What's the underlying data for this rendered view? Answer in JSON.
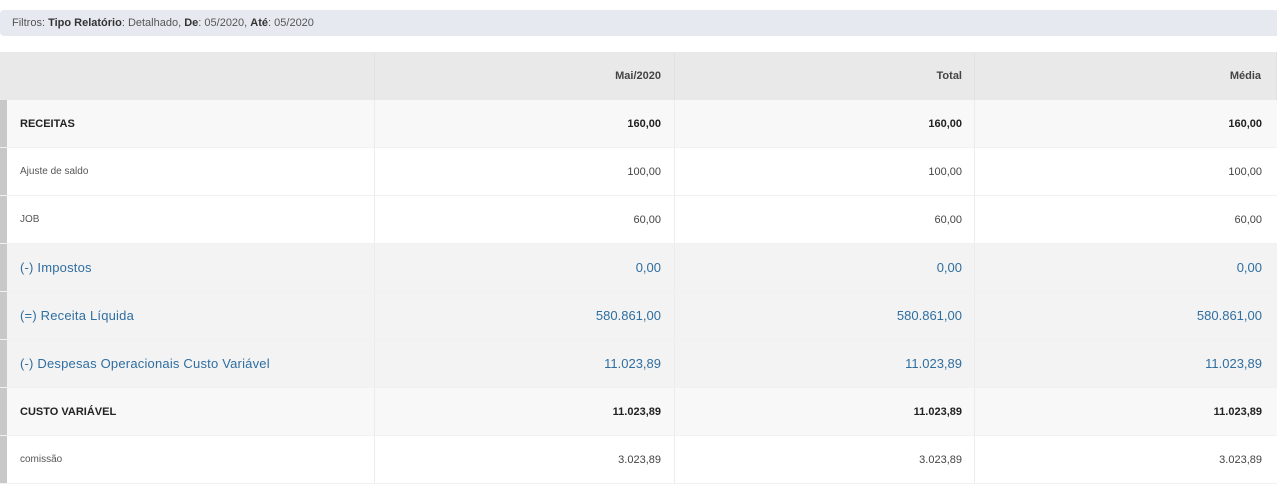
{
  "filters": {
    "prefix": "Filtros:",
    "report_type_label": "Tipo Relatório",
    "report_type_value": "Detalhado",
    "from_label": "De",
    "from_value": "05/2020",
    "to_label": "Até",
    "to_value": "05/2020"
  },
  "table": {
    "columns": [
      "",
      "Mai/2020",
      "Total",
      "Média"
    ],
    "rows": [
      {
        "label": "RECEITAS",
        "values": [
          "160,00",
          "160,00",
          "160,00"
        ]
      },
      {
        "label": "Ajuste de saldo",
        "values": [
          "100,00",
          "100,00",
          "100,00"
        ]
      },
      {
        "label": "JOB",
        "values": [
          "60,00",
          "60,00",
          "60,00"
        ]
      },
      {
        "label": "(-) Impostos",
        "values": [
          "0,00",
          "0,00",
          "0,00"
        ]
      },
      {
        "label": "(=) Receita Líquida",
        "values": [
          "580.861,00",
          "580.861,00",
          "580.861,00"
        ]
      },
      {
        "label": "(-) Despesas Operacionais Custo Variável",
        "values": [
          "11.023,89",
          "11.023,89",
          "11.023,89"
        ]
      },
      {
        "label": "CUSTO VARIÁVEL",
        "values": [
          "11.023,89",
          "11.023,89",
          "11.023,89"
        ]
      },
      {
        "label": "comissão",
        "values": [
          "3.023,89",
          "3.023,89",
          "3.023,89"
        ]
      }
    ]
  },
  "colors": {
    "filter_bar_bg": "#e6eaf0",
    "header_bg": "#e9e9e9",
    "total_row_text": "#2f6ea0",
    "row_marker": "#c8c8c8"
  }
}
